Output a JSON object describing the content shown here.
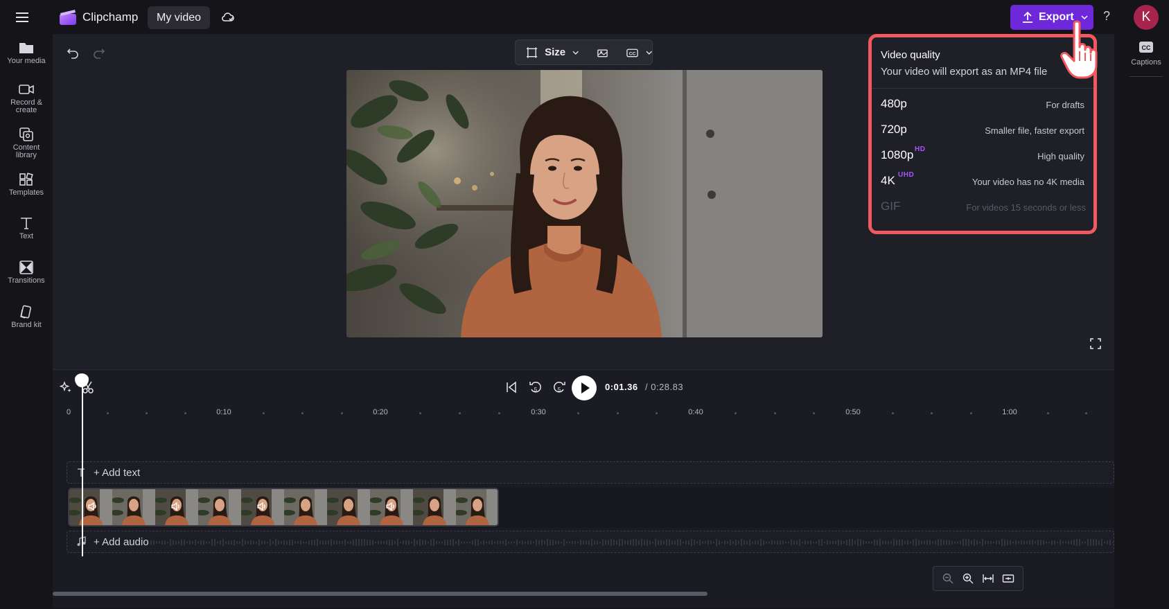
{
  "app": {
    "title": "Clipchamp",
    "project_name": "My video",
    "avatar_initial": "K"
  },
  "header": {
    "export_label": "Export",
    "help_label": "?"
  },
  "sidebar": {
    "items": [
      {
        "label": "Your media",
        "icon": "folder-icon"
      },
      {
        "label": "Record &",
        "label2": "create",
        "icon": "camera-icon"
      },
      {
        "label": "Content",
        "label2": "library",
        "icon": "content-library-icon"
      },
      {
        "label": "Templates",
        "icon": "templates-icon"
      },
      {
        "label": "Text",
        "icon": "text-icon"
      },
      {
        "label": "Transitions",
        "icon": "transitions-icon"
      },
      {
        "label": "Brand kit",
        "icon": "brand-kit-icon"
      }
    ]
  },
  "right_sidebar": {
    "captions_label": "Captions"
  },
  "toolbar": {
    "size_label": "Size"
  },
  "playback": {
    "current_time": "0:01.36",
    "total_time": "/ 0:28.83"
  },
  "ruler": {
    "ticks": [
      "0",
      "0:10",
      "0:20",
      "0:30",
      "0:40",
      "0:50",
      "1:00"
    ]
  },
  "tracks": {
    "add_text": "+ Add text",
    "add_audio": "+ Add audio"
  },
  "export_menu": {
    "title": "Video quality",
    "subtitle": "Your video will export as an MP4 file",
    "options": [
      {
        "name": "480p",
        "badge": "",
        "desc": "For drafts",
        "enabled": true
      },
      {
        "name": "720p",
        "badge": "",
        "desc": "Smaller file, faster export",
        "enabled": true
      },
      {
        "name": "1080p",
        "badge": "HD",
        "desc": "High quality",
        "enabled": true
      },
      {
        "name": "4K",
        "badge": "UHD",
        "desc": "Your video has no 4K media",
        "enabled": true
      },
      {
        "name": "GIF",
        "badge": "",
        "desc": "For videos 15 seconds or less",
        "enabled": false
      }
    ]
  },
  "colors": {
    "accent": "#6d28d9",
    "highlight": "#f2585f",
    "badge": "#a855f7"
  }
}
